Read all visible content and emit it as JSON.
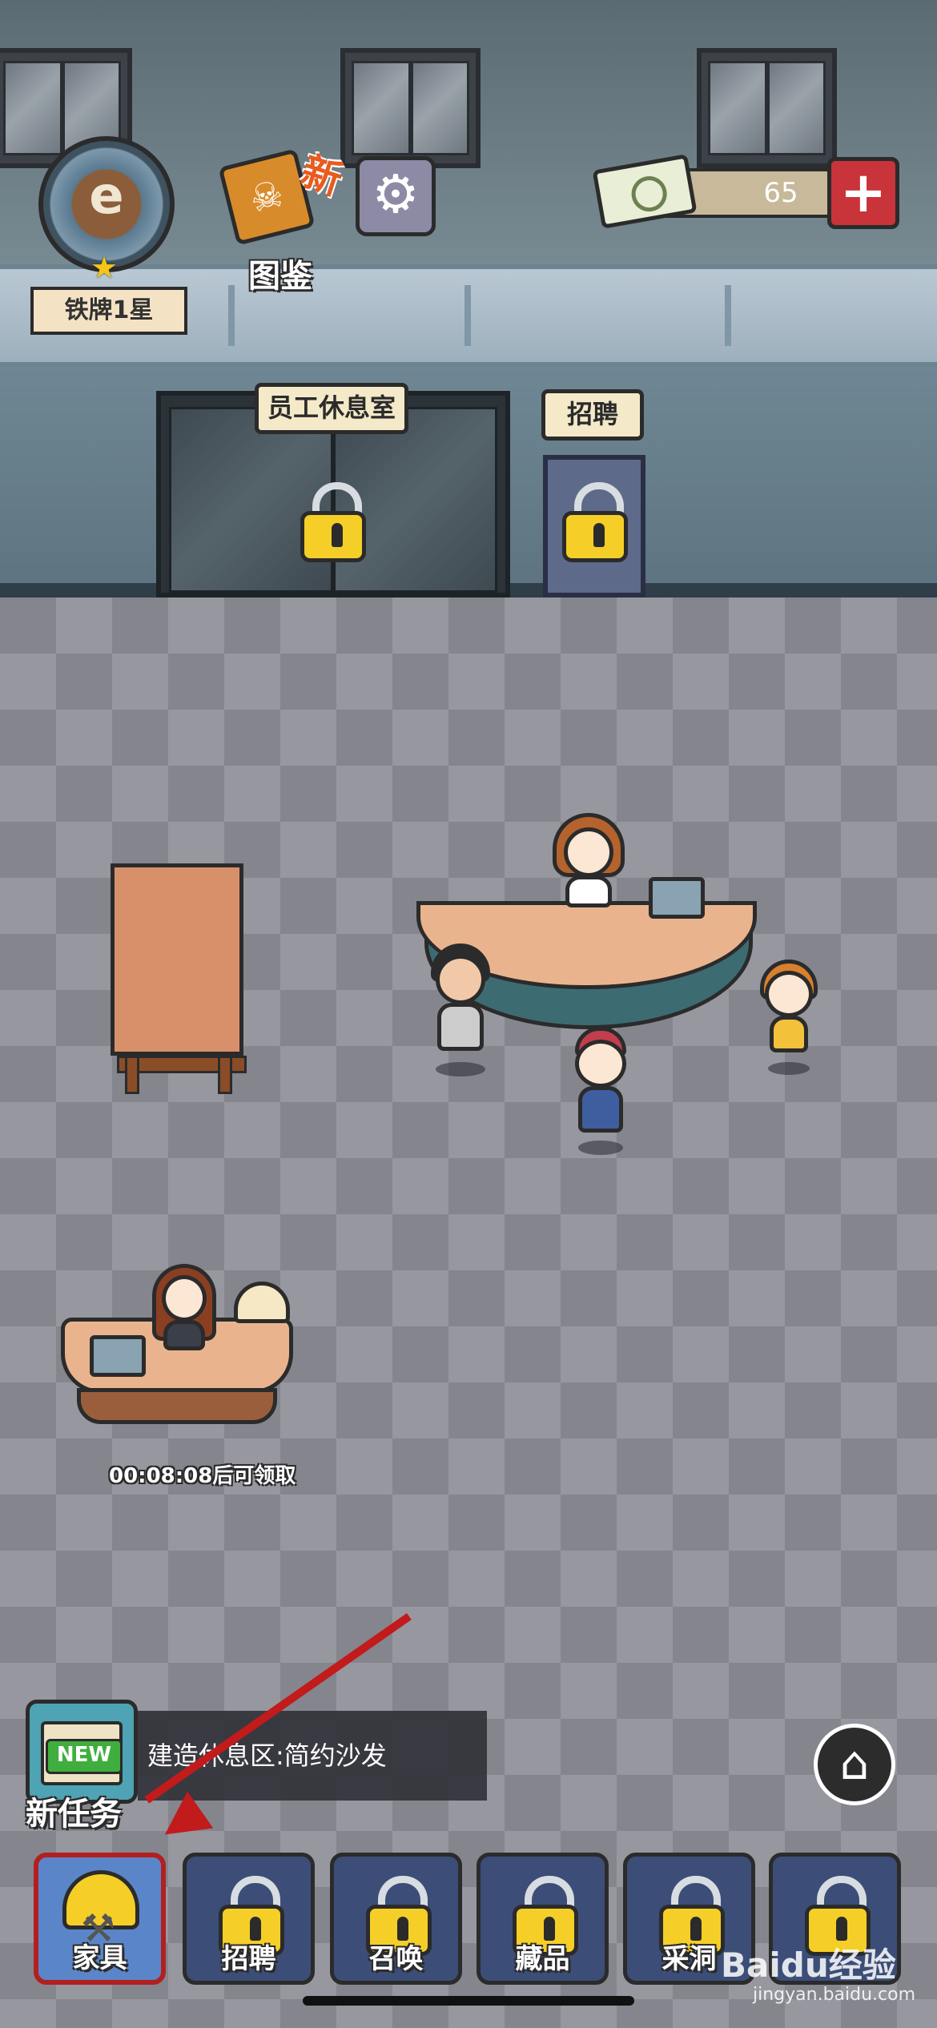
{
  "hud": {
    "badge_label": "铁牌1星",
    "collection_label": "图鉴",
    "new_marker": "新",
    "money_amount": "65",
    "plus_symbol": "+"
  },
  "rooms": {
    "staff_lounge_sign": "员工休息室",
    "recruit_sign": "招聘"
  },
  "reception": {
    "claim_timer": "00:08:08后可领取"
  },
  "task": {
    "new_badge": "NEW",
    "label": "新任务",
    "description": "建造休息区:简约沙发"
  },
  "bottom_nav": [
    {
      "label": "家具",
      "locked": false,
      "active": true
    },
    {
      "label": "招聘",
      "locked": true,
      "active": false
    },
    {
      "label": "召唤",
      "locked": true,
      "active": false
    },
    {
      "label": "藏品",
      "locked": true,
      "active": false
    },
    {
      "label": "采洞",
      "locked": true,
      "active": false
    },
    {
      "label": "",
      "locked": true,
      "active": false
    }
  ],
  "watermark": {
    "text": "Baidu经验",
    "sub": "jingyan.baidu.com"
  },
  "colors": {
    "accent_red": "#c21b1b",
    "lock_yellow": "#f5cf27",
    "nav_blue": "#3c4e77"
  }
}
